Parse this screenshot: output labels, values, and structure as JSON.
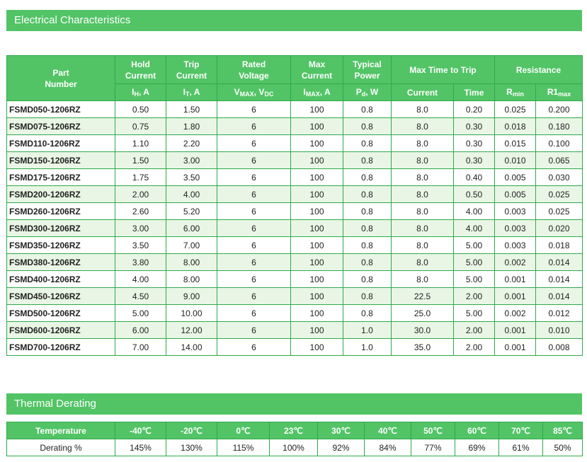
{
  "sections": {
    "electrical_title": "Electrical Characteristics",
    "thermal_title": "Thermal Derating"
  },
  "electrical": {
    "header": {
      "part": "Part\nNumber",
      "hold": "Hold\nCurrent",
      "trip": "Trip\nCurrent",
      "rated": "Rated\nVoltage",
      "max": "Max\nCurrent",
      "power": "Typical\nPower",
      "time_to_trip": "Max Time to Trip",
      "resistance": "Resistance",
      "current_sub": "Current",
      "time_sub": "Time"
    },
    "units": [
      {
        "base": "I",
        "sub": "H",
        "tail": ", A"
      },
      {
        "base": "I",
        "sub": "T",
        "tail": ", A"
      },
      {
        "base": "V",
        "sub": "MAX",
        "tail": ", V",
        "sub2": "DC"
      },
      {
        "base": "I",
        "sub": "MAX",
        "tail": ", A"
      },
      {
        "base": "P",
        "sub": "d",
        "tail": ", W"
      }
    ],
    "resistance_units": [
      {
        "base": "R",
        "sub": "min"
      },
      {
        "base": "R1",
        "sub": "max"
      }
    ],
    "rows": [
      [
        "FSMD050-1206RZ",
        "0.50",
        "1.50",
        "6",
        "100",
        "0.8",
        "8.0",
        "0.20",
        "0.025",
        "0.200"
      ],
      [
        "FSMD075-1206RZ",
        "0.75",
        "1.80",
        "6",
        "100",
        "0.8",
        "8.0",
        "0.30",
        "0.018",
        "0.180"
      ],
      [
        "FSMD110-1206RZ",
        "1.10",
        "2.20",
        "6",
        "100",
        "0.8",
        "8.0",
        "0.30",
        "0.015",
        "0.100"
      ],
      [
        "FSMD150-1206RZ",
        "1.50",
        "3.00",
        "6",
        "100",
        "0.8",
        "8.0",
        "0.30",
        "0.010",
        "0.065"
      ],
      [
        "FSMD175-1206RZ",
        "1.75",
        "3.50",
        "6",
        "100",
        "0.8",
        "8.0",
        "0.40",
        "0.005",
        "0.030"
      ],
      [
        "FSMD200-1206RZ",
        "2.00",
        "4.00",
        "6",
        "100",
        "0.8",
        "8.0",
        "0.50",
        "0.005",
        "0.025"
      ],
      [
        "FSMD260-1206RZ",
        "2.60",
        "5.20",
        "6",
        "100",
        "0.8",
        "8.0",
        "4.00",
        "0.003",
        "0.025"
      ],
      [
        "FSMD300-1206RZ",
        "3.00",
        "6.00",
        "6",
        "100",
        "0.8",
        "8.0",
        "4.00",
        "0.003",
        "0.020"
      ],
      [
        "FSMD350-1206RZ",
        "3.50",
        "7.00",
        "6",
        "100",
        "0.8",
        "8.0",
        "5.00",
        "0.003",
        "0.018"
      ],
      [
        "FSMD380-1206RZ",
        "3.80",
        "8.00",
        "6",
        "100",
        "0.8",
        "8.0",
        "5.00",
        "0.002",
        "0.014"
      ],
      [
        "FSMD400-1206RZ",
        "4.00",
        "8.00",
        "6",
        "100",
        "0.8",
        "8.0",
        "5.00",
        "0.001",
        "0.014"
      ],
      [
        "FSMD450-1206RZ",
        "4.50",
        "9.00",
        "6",
        "100",
        "0.8",
        "22.5",
        "2.00",
        "0.001",
        "0.014"
      ],
      [
        "FSMD500-1206RZ",
        "5.00",
        "10.00",
        "6",
        "100",
        "0.8",
        "25.0",
        "5.00",
        "0.002",
        "0.012"
      ],
      [
        "FSMD600-1206RZ",
        "6.00",
        "12.00",
        "6",
        "100",
        "1.0",
        "30.0",
        "2.00",
        "0.001",
        "0.010"
      ],
      [
        "FSMD700-1206RZ",
        "7.00",
        "14.00",
        "6",
        "100",
        "1.0",
        "35.0",
        "2.00",
        "0.001",
        "0.008"
      ]
    ]
  },
  "thermal": {
    "header": [
      "Temperature",
      "-40℃",
      "-20℃",
      "0℃",
      "23℃",
      "30℃",
      "40℃",
      "50℃",
      "60℃",
      "70℃",
      "85℃"
    ],
    "row": [
      "Derating %",
      "145%",
      "130%",
      "115%",
      "100%",
      "92%",
      "84%",
      "77%",
      "69%",
      "61%",
      "50%"
    ]
  }
}
